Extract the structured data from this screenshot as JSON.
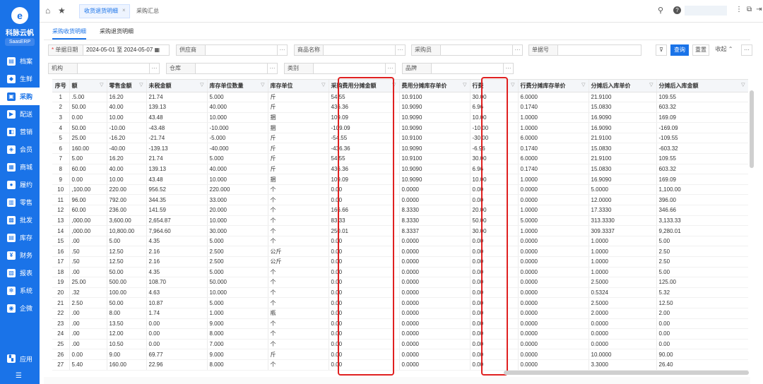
{
  "sidebar": {
    "logo_char": "e",
    "brand": "科脉云帆",
    "badge": "SaasERP",
    "items": [
      {
        "label": "档案",
        "icon": "▤"
      },
      {
        "label": "生鲜",
        "icon": "◆"
      },
      {
        "label": "采购",
        "icon": "▣"
      },
      {
        "label": "配送",
        "icon": "▶"
      },
      {
        "label": "营销",
        "icon": "◧"
      },
      {
        "label": "会员",
        "icon": "◈"
      },
      {
        "label": "商城",
        "icon": "▦"
      },
      {
        "label": "履约",
        "icon": "●"
      },
      {
        "label": "零售",
        "icon": "▥"
      },
      {
        "label": "批发",
        "icon": "▩"
      },
      {
        "label": "库存",
        "icon": "▤"
      },
      {
        "label": "财务",
        "icon": "¥"
      },
      {
        "label": "报表",
        "icon": "▧"
      },
      {
        "label": "系统",
        "icon": "✻"
      },
      {
        "label": "企微",
        "icon": "◉"
      }
    ],
    "active_index": 2,
    "bottom_label": "应用",
    "bottom_icon": "▚"
  },
  "topbar": {
    "tabs": [
      {
        "label": "收货退货明细",
        "active": true
      },
      {
        "label": "采购汇总",
        "active": false
      }
    ],
    "close_glyph": "×"
  },
  "subtabs": [
    "采购收货明细",
    "采购退货明细"
  ],
  "filters": {
    "row1": [
      {
        "label": "单据日期",
        "required": true,
        "value": "2024-05-01 至  2024-05-07"
      },
      {
        "label": "供应商",
        "value": ""
      },
      {
        "label": "商品名称",
        "value": ""
      },
      {
        "label": "采购员",
        "value": ""
      },
      {
        "label": "单据号",
        "value": ""
      }
    ],
    "row2": [
      {
        "label": "机构",
        "value": ""
      },
      {
        "label": "仓库",
        "value": ""
      },
      {
        "label": "类别",
        "value": ""
      },
      {
        "label": "品牌",
        "value": ""
      }
    ],
    "ellipsis": "···"
  },
  "actions": {
    "filter_icon": "filter-icon",
    "query": "查询",
    "reset": "重置",
    "collapse": "收起 ⌃",
    "more": "···"
  },
  "table": {
    "columns": [
      "序号",
      "额",
      "零售金额",
      "未税金额",
      "库存单位数量",
      "库存单位",
      "采购费用分摊金额",
      "费用分摊库存单价",
      "行费",
      "行费分摊库存单价",
      "分摊后入库单价",
      "分摊后入库金额"
    ],
    "rows": [
      [
        "1",
        ".5.00",
        "16.20",
        "21.74",
        "5.000",
        "斤",
        "54.55",
        "10.9100",
        "30.00",
        "6.0000",
        "21.9100",
        "109.55"
      ],
      [
        "2",
        "50.00",
        "40.00",
        "139.13",
        "40.000",
        "斤",
        "436.36",
        "10.9090",
        "6.96",
        "0.1740",
        "15.0830",
        "603.32"
      ],
      [
        "3",
        "0.00",
        "10.00",
        "43.48",
        "10.000",
        "捆",
        "109.09",
        "10.9090",
        "10.00",
        "1.0000",
        "16.9090",
        "169.09"
      ],
      [
        "4",
        "50.00",
        "-10.00",
        "-43.48",
        "-10.000",
        "捆",
        "-109.09",
        "10.9090",
        "-10.00",
        "1.0000",
        "16.9090",
        "-169.09"
      ],
      [
        "5",
        "25.00",
        "-16.20",
        "-21.74",
        "-5.000",
        "斤",
        "-54.55",
        "10.9100",
        "-30.00",
        "6.0000",
        "21.9100",
        "-109.55"
      ],
      [
        "6",
        "160.00",
        "-40.00",
        "-139.13",
        "-40.000",
        "斤",
        "-436.36",
        "10.9090",
        "-6.96",
        "0.1740",
        "15.0830",
        "-603.32"
      ],
      [
        "7",
        "5.00",
        "16.20",
        "21.74",
        "5.000",
        "斤",
        "54.55",
        "10.9100",
        "30.00",
        "6.0000",
        "21.9100",
        "109.55"
      ],
      [
        "8",
        "60.00",
        "40.00",
        "139.13",
        "40.000",
        "斤",
        "436.36",
        "10.9090",
        "6.96",
        "0.1740",
        "15.0830",
        "603.32"
      ],
      [
        "9",
        "0.00",
        "10.00",
        "43.48",
        "10.000",
        "捆",
        "109.09",
        "10.9090",
        "10.00",
        "1.0000",
        "16.9090",
        "169.09"
      ],
      [
        "10",
        ",100.00",
        "220.00",
        "956.52",
        "220.000",
        "个",
        "0.00",
        "0.0000",
        "0.00",
        "0.0000",
        "5.0000",
        "1,100.00"
      ],
      [
        "11",
        "96.00",
        "792.00",
        "344.35",
        "33.000",
        "个",
        "0.00",
        "0.0000",
        "0.00",
        "0.0000",
        "12.0000",
        "396.00"
      ],
      [
        "12",
        "60.00",
        "236.00",
        "141.59",
        "20.000",
        "个",
        "166.66",
        "8.3330",
        "20.00",
        "1.0000",
        "17.3330",
        "346.66"
      ],
      [
        "13",
        ",000.00",
        "3,600.00",
        "2,654.87",
        "10.000",
        "个",
        "83.33",
        "8.3330",
        "50.00",
        "5.0000",
        "313.3330",
        "3,133.33"
      ],
      [
        "14",
        ",000.00",
        "10,800.00",
        "7,964.60",
        "30.000",
        "个",
        "250.01",
        "8.3337",
        "30.00",
        "1.0000",
        "309.3337",
        "9,280.01"
      ],
      [
        "15",
        ".00",
        "5.00",
        "4.35",
        "5.000",
        "个",
        "0.00",
        "0.0000",
        "0.00",
        "0.0000",
        "1.0000",
        "5.00"
      ],
      [
        "16",
        ".50",
        "12.50",
        "2.16",
        "2.500",
        "公斤",
        "0.00",
        "0.0000",
        "0.00",
        "0.0000",
        "1.0000",
        "2.50"
      ],
      [
        "17",
        ".50",
        "12.50",
        "2.16",
        "2.500",
        "公斤",
        "0.00",
        "0.0000",
        "0.00",
        "0.0000",
        "1.0000",
        "2.50"
      ],
      [
        "18",
        ".00",
        "50.00",
        "4.35",
        "5.000",
        "个",
        "0.00",
        "0.0000",
        "0.00",
        "0.0000",
        "1.0000",
        "5.00"
      ],
      [
        "19",
        "25.00",
        "500.00",
        "108.70",
        "50.000",
        "个",
        "0.00",
        "0.0000",
        "0.00",
        "0.0000",
        "2.5000",
        "125.00"
      ],
      [
        "20",
        ".32",
        "100.00",
        "4.63",
        "10.000",
        "个",
        "0.00",
        "0.0000",
        "0.00",
        "0.0000",
        "0.5324",
        "5.32"
      ],
      [
        "21",
        "2.50",
        "50.00",
        "10.87",
        "5.000",
        "个",
        "0.00",
        "0.0000",
        "0.00",
        "0.0000",
        "2.5000",
        "12.50"
      ],
      [
        "22",
        ".00",
        "8.00",
        "1.74",
        "1.000",
        "瓶",
        "0.00",
        "0.0000",
        "0.00",
        "0.0000",
        "2.0000",
        "2.00"
      ],
      [
        "23",
        ".00",
        "13.50",
        "0.00",
        "9.000",
        "个",
        "0.00",
        "0.0000",
        "0.00",
        "0.0000",
        "0.0000",
        "0.00"
      ],
      [
        "24",
        ".00",
        "12.00",
        "0.00",
        "8.000",
        "个",
        "0.00",
        "0.0000",
        "0.00",
        "0.0000",
        "0.0000",
        "0.00"
      ],
      [
        "25",
        ".00",
        "10.50",
        "0.00",
        "7.000",
        "个",
        "0.00",
        "0.0000",
        "0.00",
        "0.0000",
        "0.0000",
        "0.00"
      ],
      [
        "26",
        "0.00",
        "9.00",
        "69.77",
        "9.000",
        "斤",
        "0.00",
        "0.0000",
        "0.00",
        "0.0000",
        "10.0000",
        "90.00"
      ],
      [
        "27",
        "5.40",
        "160.00",
        "22.96",
        "8.000",
        "个",
        "0.00",
        "0.0000",
        "0.00",
        "0.0000",
        "3.3000",
        "26.40"
      ]
    ]
  },
  "colors": {
    "primary": "#1a73e8",
    "highlight": "#e02020"
  }
}
